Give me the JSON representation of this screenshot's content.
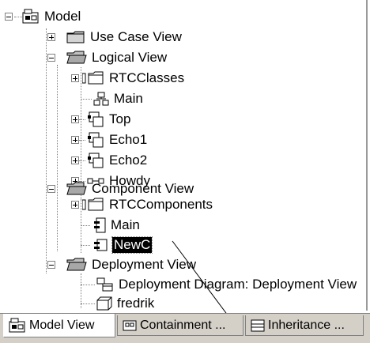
{
  "tree": {
    "nodes": [
      {
        "id": "model",
        "label": "Model",
        "icon": "package-model-icon",
        "expander": "minus"
      },
      {
        "id": "use-case-view",
        "label": "Use Case View",
        "icon": "folder-icon",
        "expander": "plus"
      },
      {
        "id": "logical-view",
        "label": "Logical View",
        "icon": "open-folder-icon",
        "expander": "minus"
      },
      {
        "id": "rtcclasses",
        "label": "RTCClasses",
        "icon": "package-folder-icon",
        "expander": "plus"
      },
      {
        "id": "main-diagram",
        "label": "Main",
        "icon": "class-diagram-icon",
        "expander": null
      },
      {
        "id": "top",
        "label": "Top",
        "icon": "capsule-icon",
        "expander": "plus"
      },
      {
        "id": "echo1",
        "label": "Echo1",
        "icon": "capsule-icon",
        "expander": "plus"
      },
      {
        "id": "echo2",
        "label": "Echo2",
        "icon": "capsule-icon",
        "expander": "plus"
      },
      {
        "id": "howdy",
        "label": "Howdy",
        "icon": "protocol-icon",
        "expander": "plus"
      },
      {
        "id": "component-view",
        "label": "Component View",
        "icon": "open-folder-icon",
        "expander": "minus"
      },
      {
        "id": "rtccomponents",
        "label": "RTCComponents",
        "icon": "package-folder-icon",
        "expander": "plus"
      },
      {
        "id": "main-component",
        "label": "Main",
        "icon": "component-diagram-icon",
        "expander": null
      },
      {
        "id": "new-component",
        "label": "NewC",
        "icon": "component-icon",
        "expander": null,
        "selected": true
      },
      {
        "id": "deployment-view",
        "label": "Deployment View",
        "icon": "open-folder-icon",
        "expander": "minus"
      },
      {
        "id": "deployment-diagram",
        "label": "Deployment Diagram: Deployment View",
        "icon": "deployment-diagram-icon",
        "expander": null
      },
      {
        "id": "fredrik",
        "label": "fredrik",
        "icon": "processor-node-icon",
        "expander": null
      }
    ]
  },
  "tabs": [
    {
      "label": "Model View",
      "icon": "model-view-icon",
      "active": true
    },
    {
      "label": "Containment ...",
      "icon": "containment-icon",
      "active": false
    },
    {
      "label": "Inheritance ...",
      "icon": "inheritance-icon",
      "active": false
    }
  ]
}
